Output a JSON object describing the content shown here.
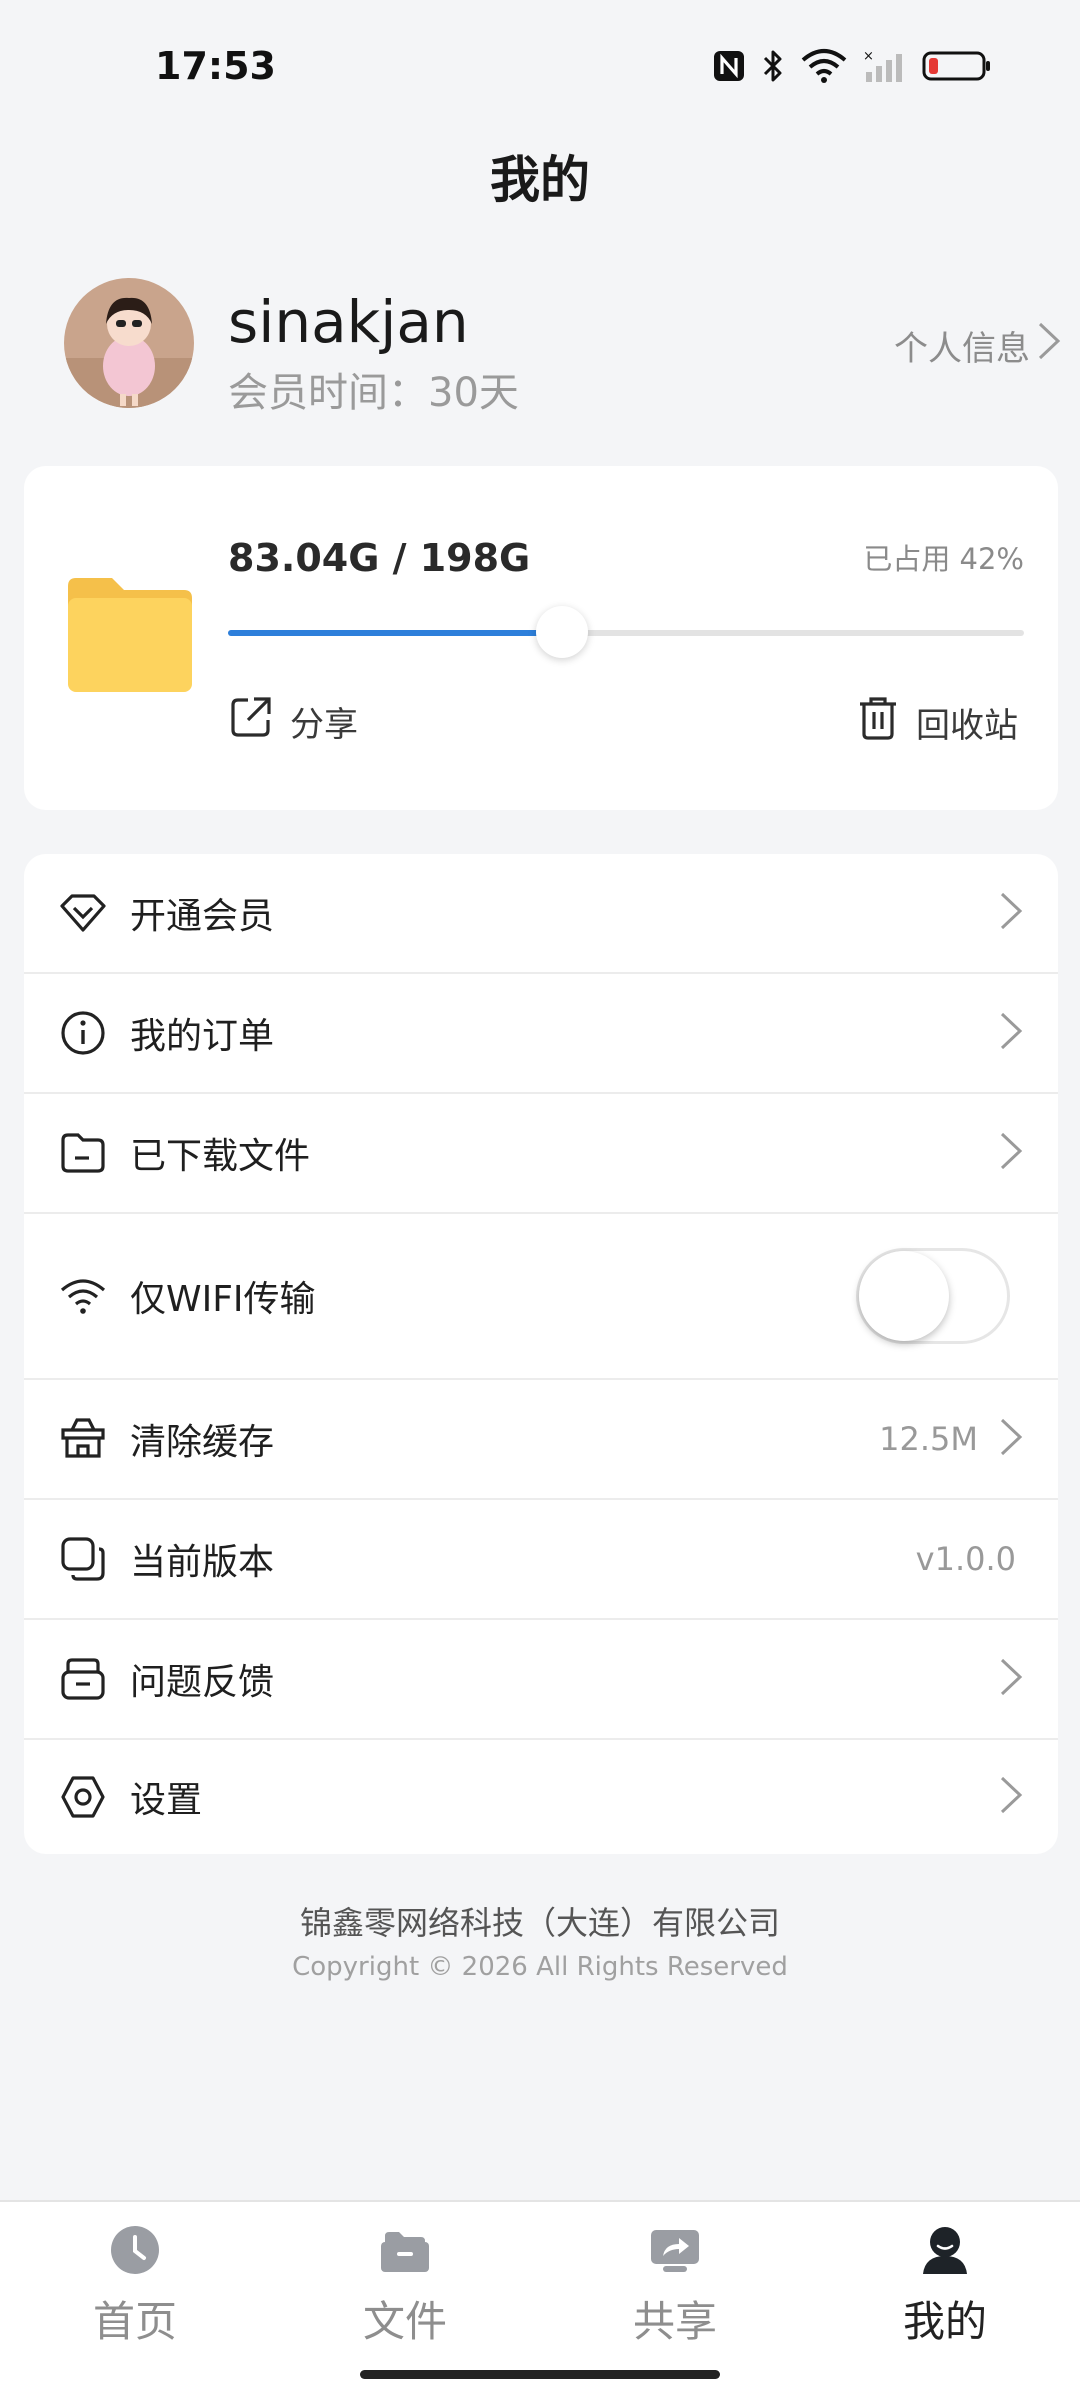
{
  "status_bar": {
    "time": "17:53",
    "icons": [
      "nfc-icon",
      "bluetooth-icon",
      "wifi-icon",
      "signal-icon",
      "battery-icon"
    ],
    "battery_color": "#e53935"
  },
  "page": {
    "title": "我的"
  },
  "profile": {
    "username": "sinakjan",
    "member_label": "会员时间：",
    "member_value": "30天",
    "info_link": "个人信息"
  },
  "storage": {
    "usage_text": "83.04G / 198G",
    "percent_text": "已占用 42%",
    "used_fraction": 0.42,
    "accent_color": "#2d7fdb",
    "share_label": "分享",
    "recycle_label": "回收站"
  },
  "menu": {
    "items": [
      {
        "label": "开通会员",
        "icon": "diamond-icon"
      },
      {
        "label": "我的订单",
        "icon": "info-icon"
      },
      {
        "label": "已下载文件",
        "icon": "folder-icon"
      },
      {
        "label": "仅WIFI传输",
        "icon": "wifi-icon",
        "toggle_on": false
      },
      {
        "label": "清除缓存",
        "icon": "clear-cache-icon",
        "value": "12.5M"
      },
      {
        "label": "当前版本",
        "icon": "version-icon",
        "value": "v1.0.0"
      },
      {
        "label": "问题反馈",
        "icon": "feedback-icon"
      },
      {
        "label": "设置",
        "icon": "settings-icon"
      }
    ]
  },
  "footer": {
    "company": "锦鑫零网络科技（大连）有限公司",
    "copyright": "Copyright © 2026 All Rights Reserved"
  },
  "nav": {
    "items": [
      {
        "label": "首页",
        "icon": "clock-icon",
        "active": false
      },
      {
        "label": "文件",
        "icon": "file-box-icon",
        "active": false
      },
      {
        "label": "共享",
        "icon": "share-icon",
        "active": false
      },
      {
        "label": "我的",
        "icon": "user-icon",
        "active": true
      }
    ]
  }
}
